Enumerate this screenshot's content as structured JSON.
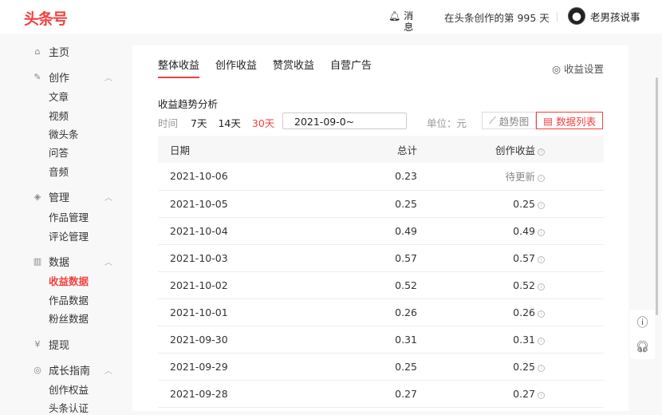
{
  "header": {
    "logo": "头条号",
    "messages": "消息",
    "days_text": "在头条创作的第 995 天",
    "username": "老男孩说事"
  },
  "sidebar": {
    "home": "主页",
    "create": {
      "label": "创作",
      "items": [
        "文章",
        "视频",
        "微头条",
        "问答",
        "音频"
      ]
    },
    "manage": {
      "label": "管理",
      "items": [
        "作品管理",
        "评论管理"
      ]
    },
    "data": {
      "label": "数据",
      "items": [
        "收益数据",
        "作品数据",
        "粉丝数据"
      ]
    },
    "withdraw": "提现",
    "growth": {
      "label": "成长指南",
      "items": [
        "创作权益",
        "头条认证"
      ]
    }
  },
  "main": {
    "tabs": [
      "整体收益",
      "创作收益",
      "赞赏收益",
      "自营广告"
    ],
    "settings": "收益设置",
    "section_title": "收益趋势分析",
    "time_label": "时间",
    "ranges": [
      "7天",
      "14天",
      "30天"
    ],
    "date_value": "2021-09-0~",
    "unit": "单位：元",
    "view_trend": "趋势图",
    "view_list": "数据列表",
    "columns": [
      "日期",
      "总计",
      "创作收益"
    ],
    "rows": [
      [
        "2021-10-06",
        "0.23",
        "待更新"
      ],
      [
        "2021-10-05",
        "0.25",
        "0.25"
      ],
      [
        "2021-10-04",
        "0.49",
        "0.49"
      ],
      [
        "2021-10-03",
        "0.57",
        "0.57"
      ],
      [
        "2021-10-02",
        "0.52",
        "0.52"
      ],
      [
        "2021-10-01",
        "0.26",
        "0.26"
      ],
      [
        "2021-09-30",
        "0.31",
        "0.31"
      ],
      [
        "2021-09-29",
        "0.25",
        "0.25"
      ],
      [
        "2021-09-28",
        "0.27",
        "0.27"
      ]
    ]
  },
  "colors": {
    "accent": "#f04142"
  }
}
